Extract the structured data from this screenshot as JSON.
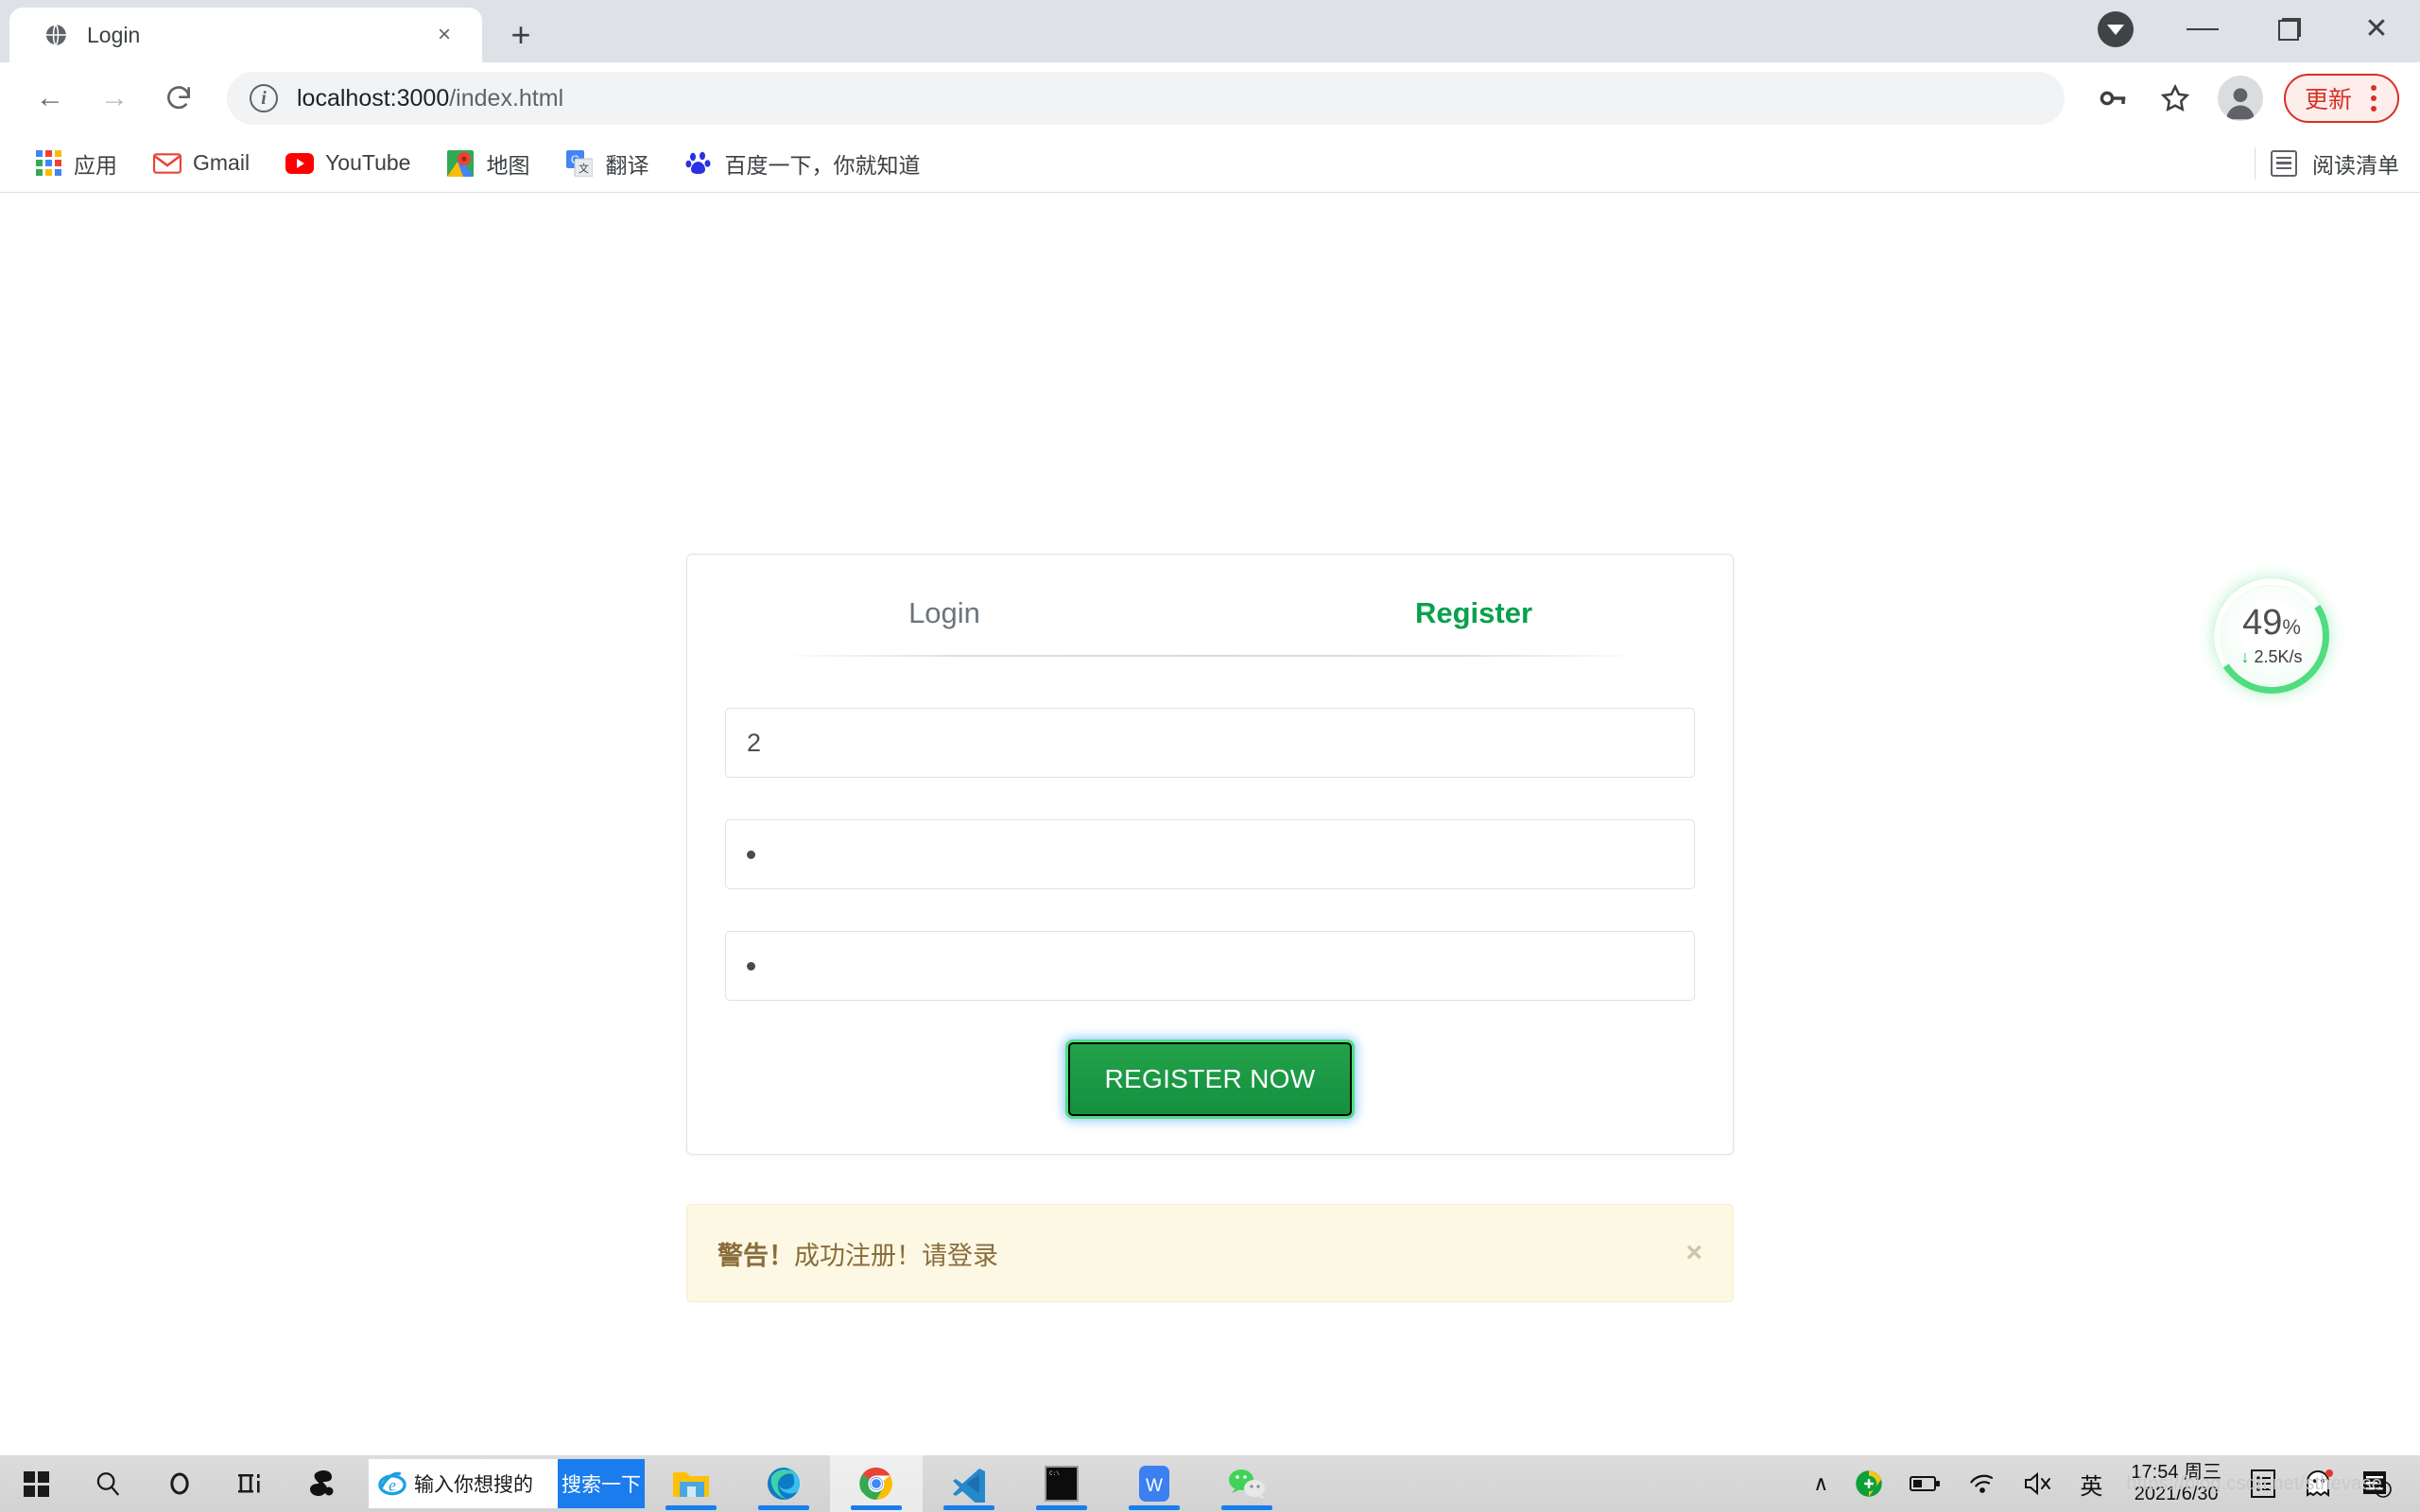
{
  "browser": {
    "tab": {
      "title": "Login",
      "favicon": "globe-icon",
      "close": "×"
    },
    "newtab_label": "+",
    "window_controls": {
      "download": "download-chevron-icon",
      "minimize": "minimize-icon",
      "maximize": "restore-icon",
      "close": "close-icon"
    },
    "toolbar": {
      "back": "←",
      "forward": "→",
      "reload": "⟳",
      "url_host": "localhost:3000",
      "url_path": "/index.html",
      "info_label": "i",
      "password_icon": "key-icon",
      "bookmark_icon": "star-icon",
      "profile_icon": "avatar-icon",
      "update_label": "更新",
      "menu_icon": "kebab-menu-icon"
    },
    "bookmarks": [
      {
        "label": "应用",
        "icon": "apps-grid-icon"
      },
      {
        "label": "Gmail",
        "icon": "gmail-icon"
      },
      {
        "label": "YouTube",
        "icon": "youtube-icon"
      },
      {
        "label": "地图",
        "icon": "google-maps-icon"
      },
      {
        "label": "翻译",
        "icon": "google-translate-icon"
      },
      {
        "label": "百度一下，你就知道",
        "icon": "baidu-icon"
      }
    ],
    "reading_list": {
      "label": "阅读清单",
      "icon": "reading-list-icon"
    }
  },
  "page": {
    "card": {
      "tabs": [
        {
          "label": "Login",
          "active": false
        },
        {
          "label": "Register",
          "active": true
        }
      ],
      "fields": [
        {
          "name": "username",
          "value": "2",
          "masked": false
        },
        {
          "name": "password",
          "value": "•",
          "masked": true
        },
        {
          "name": "confirm-password",
          "value": "•",
          "masked": true
        }
      ],
      "submit_label": "REGISTER NOW"
    },
    "alert": {
      "strong": "警告！",
      "message": "成功注册！请登录",
      "close": "×"
    },
    "speed_widget": {
      "percent": "49",
      "percent_unit": "%",
      "rate_arrow": "↓",
      "rate": "2.5K/s"
    },
    "watermark": "https://blog.csdn.net/sthevase"
  },
  "taskbar": {
    "start": "windows-start-icon",
    "search": "search-icon",
    "cortana": "cortana-icon",
    "taskview": "task-view-icon",
    "pinned_app": "sogou-icon",
    "ie_search_placeholder": "输入你想搜的",
    "search_button": "搜索一下",
    "apps": [
      {
        "name": "file-explorer-icon"
      },
      {
        "name": "microsoft-edge-icon"
      },
      {
        "name": "google-chrome-icon"
      },
      {
        "name": "vscode-icon"
      },
      {
        "name": "terminal-icon"
      },
      {
        "name": "wps-icon"
      },
      {
        "name": "wechat-icon"
      }
    ],
    "tray": {
      "chevron": "∧",
      "shield": "security-shield-icon",
      "battery": "battery-icon",
      "wifi": "wifi-icon",
      "volume": "volume-muted-icon",
      "ime": "英",
      "time": "17:54 周三",
      "date": "2021/6/30",
      "notes": "notes-icon",
      "ghost": "ghost-icon",
      "notifications": "notification-icon",
      "notification_count": "1"
    }
  },
  "colors": {
    "accent_green": "#08a14e",
    "button_green": "#1d9e45",
    "alert_bg": "#fcf8e3",
    "alert_text": "#8a6d3b",
    "update_red": "#d93025"
  }
}
